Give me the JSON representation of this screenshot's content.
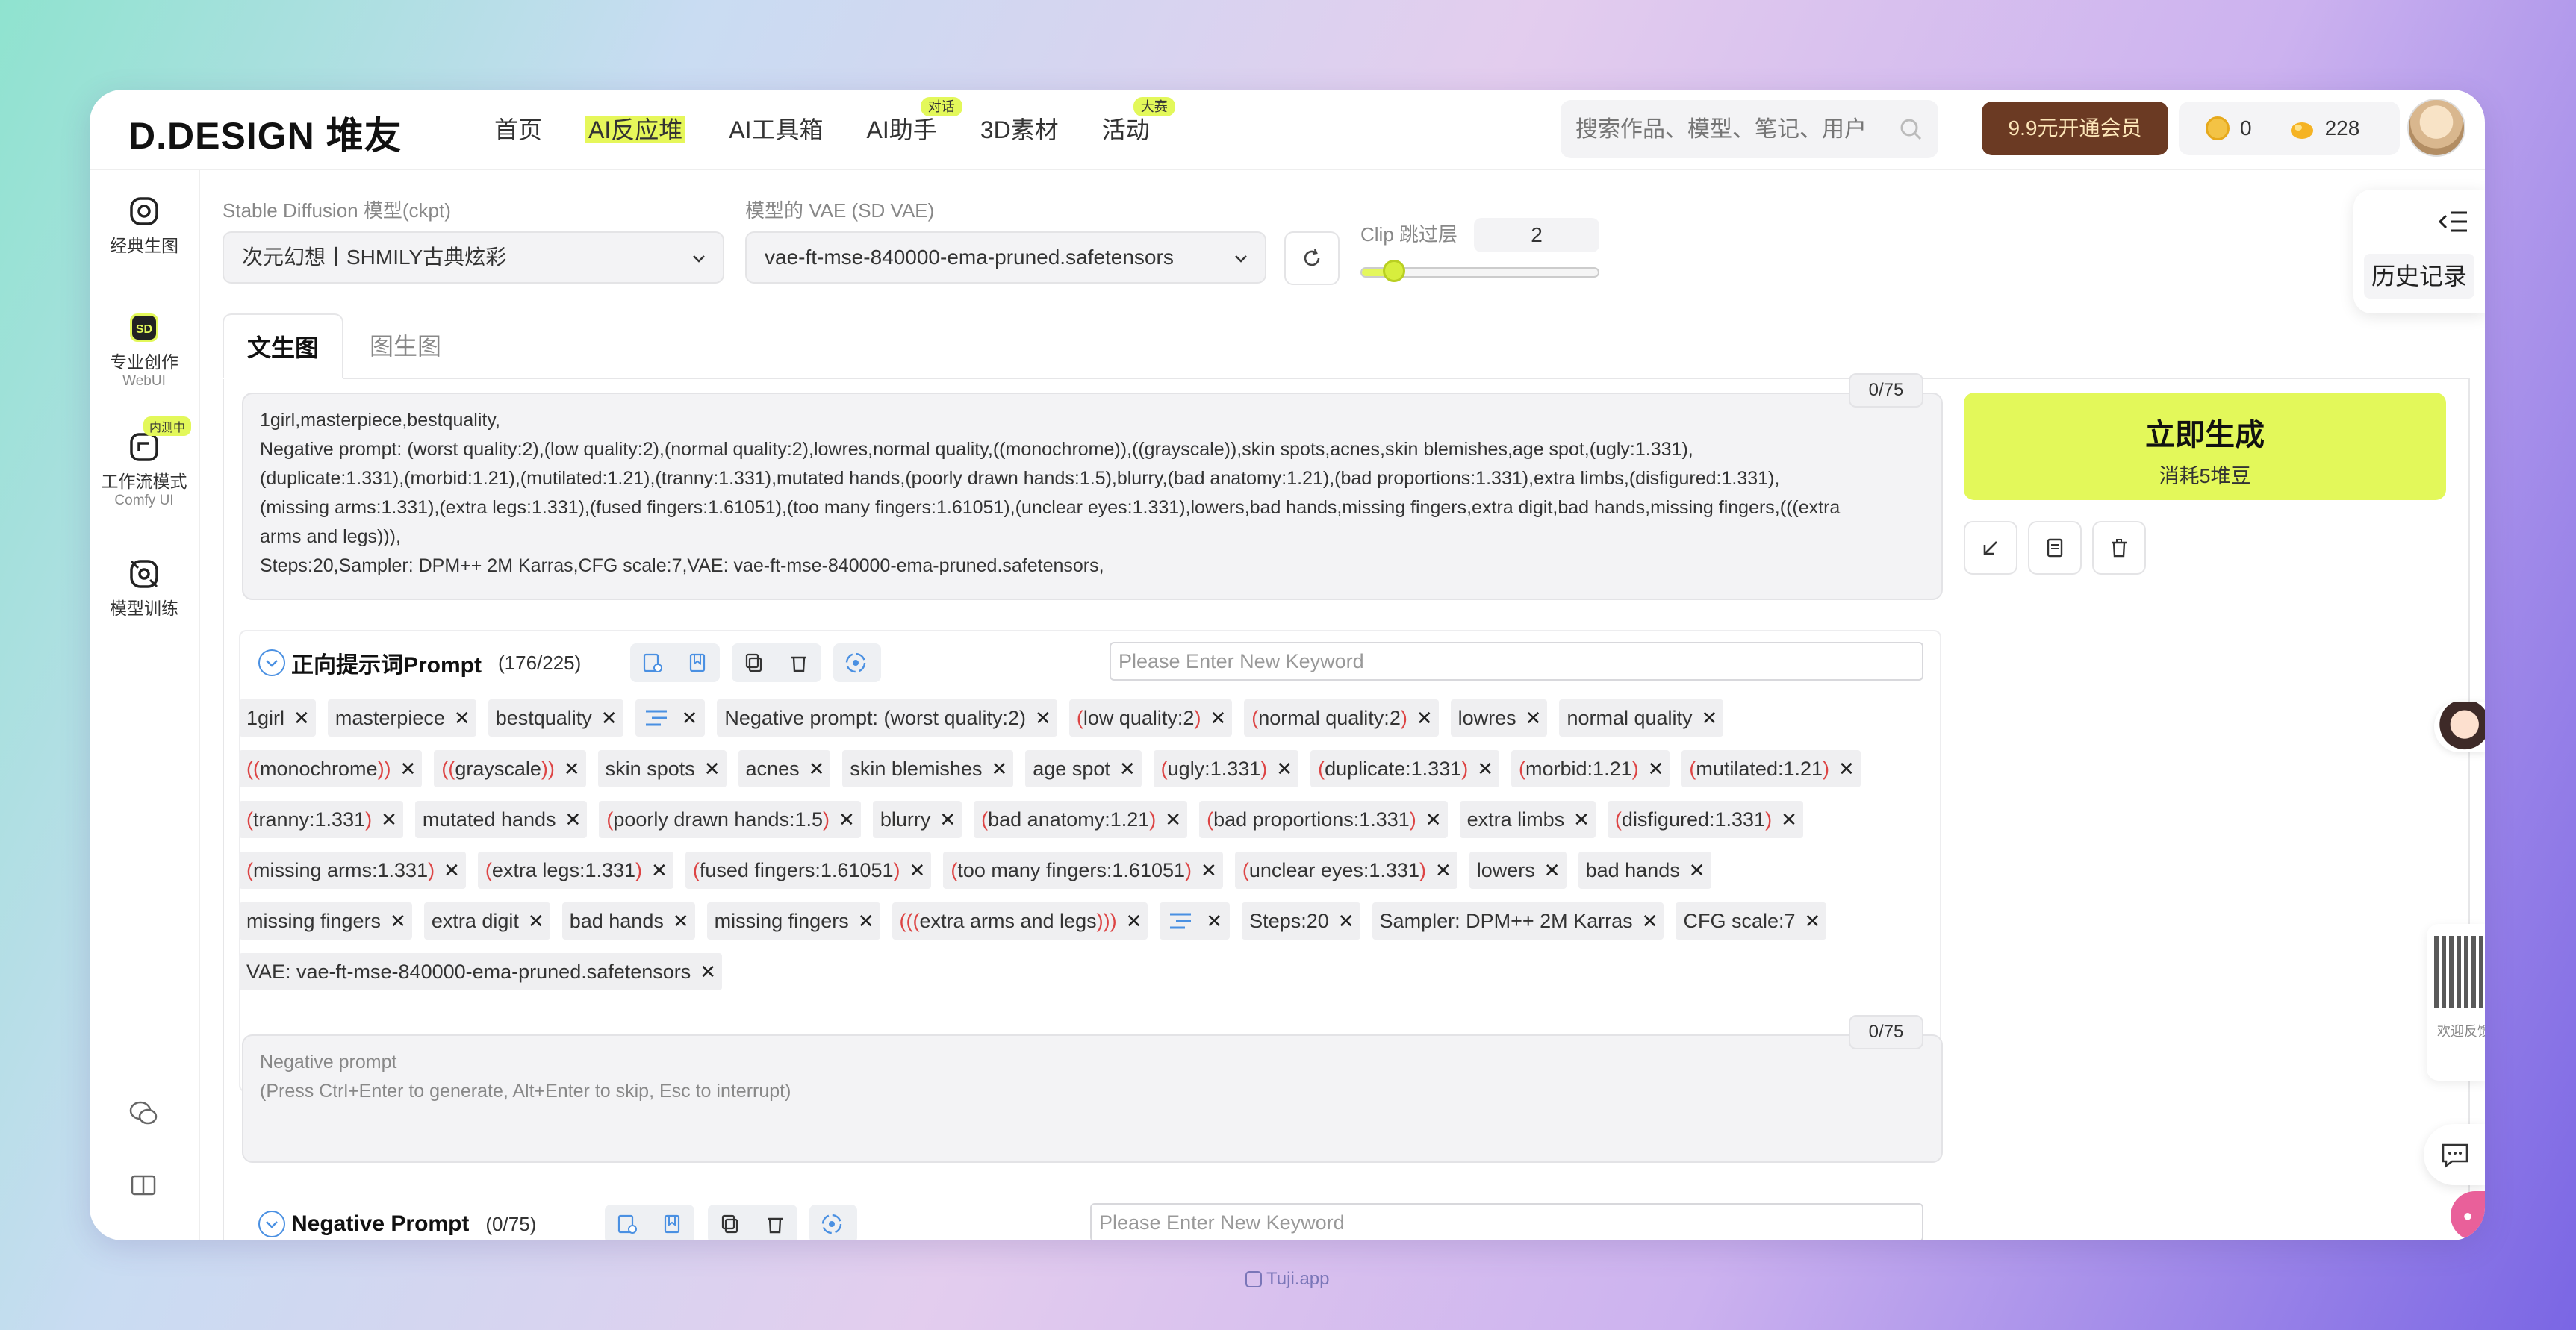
{
  "header": {
    "logo": "D.DESIGN 堆友",
    "nav": [
      {
        "label": "首页",
        "badge": ""
      },
      {
        "label": "AI反应堆",
        "badge": ""
      },
      {
        "label": "AI工具箱",
        "badge": ""
      },
      {
        "label": "AI助手",
        "badge": "对话"
      },
      {
        "label": "3D素材",
        "badge": ""
      },
      {
        "label": "活动",
        "badge": "大赛"
      }
    ],
    "search_placeholder": "搜索作品、模型、笔记、用户",
    "vip_label": "9.9元开通会员",
    "coins": "0",
    "beans": "228"
  },
  "rail": {
    "items": [
      {
        "label": "经典生图",
        "sub": "",
        "badge": ""
      },
      {
        "label": "专业创作",
        "sub": "WebUI",
        "badge": ""
      },
      {
        "label": "工作流模式",
        "sub": "Comfy UI",
        "badge": "内测中"
      },
      {
        "label": "模型训练",
        "sub": "",
        "badge": ""
      }
    ]
  },
  "settings": {
    "model_label": "Stable Diffusion 模型(ckpt)",
    "model_value": "次元幻想丨SHMILY古典炫彩",
    "vae_label": "模型的 VAE (SD VAE)",
    "vae_value": "vae-ft-mse-840000-ema-pruned.safetensors",
    "clip_label": "Clip 跳过层",
    "clip_value": "2",
    "clip_slider_fraction": 0.14
  },
  "history_label": "历史记录",
  "tabs": [
    "文生图",
    "图生图"
  ],
  "prompt": {
    "counter": "0/75",
    "text": "1girl,masterpiece,bestquality,\nNegative prompt: (worst quality:2),(low quality:2),(normal quality:2),lowres,normal quality,((monochrome)),((grayscale)),skin spots,acnes,skin blemishes,age spot,(ugly:1.331),\n(duplicate:1.331),(morbid:1.21),(mutilated:1.21),(tranny:1.331),mutated hands,(poorly drawn hands:1.5),blurry,(bad anatomy:1.21),(bad proportions:1.331),extra limbs,(disfigured:1.331),\n(missing arms:1.331),(extra legs:1.331),(fused fingers:1.61051),(too many fingers:1.61051),(unclear eyes:1.331),lowers,bad hands,missing fingers,extra digit,bad hands,missing fingers,(((extra\narms and legs))),\nSteps:20,Sampler: DPM++ 2M Karras,CFG scale:7,VAE: vae-ft-mse-840000-ema-pruned.safetensors,"
  },
  "generate": {
    "main": "立即生成",
    "sub": "消耗5堆豆"
  },
  "positive": {
    "title": "正向提示词Prompt",
    "count": "(176/225)",
    "keyword_placeholder": "Please Enter New Keyword",
    "rows": [
      [
        {
          "pre": "",
          "text": "1girl",
          "post": ""
        },
        {
          "pre": "",
          "text": "masterpiece",
          "post": ""
        },
        {
          "pre": "",
          "text": "bestquality",
          "post": ""
        },
        {
          "break": true
        },
        {
          "pre": "",
          "text": "Negative prompt: (worst quality:2)",
          "post": ""
        },
        {
          "pre": "(",
          "text": "low quality:2",
          "post": ")"
        },
        {
          "pre": "(",
          "text": "normal quality:2",
          "post": ")"
        },
        {
          "pre": "",
          "text": "lowres",
          "post": ""
        },
        {
          "pre": "",
          "text": "normal quality",
          "post": ""
        }
      ],
      [
        {
          "pre": "((",
          "text": "monochrome",
          "post": "))"
        },
        {
          "pre": "((",
          "text": "grayscale",
          "post": "))"
        },
        {
          "pre": "",
          "text": "skin spots",
          "post": ""
        },
        {
          "pre": "",
          "text": "acnes",
          "post": ""
        },
        {
          "pre": "",
          "text": "skin blemishes",
          "post": ""
        },
        {
          "pre": "",
          "text": "age spot",
          "post": ""
        },
        {
          "pre": "(",
          "text": "ugly:1.331",
          "post": ")"
        },
        {
          "pre": "(",
          "text": "duplicate:1.331",
          "post": ")"
        },
        {
          "pre": "(",
          "text": "morbid:1.21",
          "post": ")"
        },
        {
          "pre": "(",
          "text": "mutilated:1.21",
          "post": ")"
        }
      ],
      [
        {
          "pre": "(",
          "text": "tranny:1.331",
          "post": ")"
        },
        {
          "pre": "",
          "text": "mutated hands",
          "post": ""
        },
        {
          "pre": "(",
          "text": "poorly drawn hands:1.5",
          "post": ")"
        },
        {
          "pre": "",
          "text": "blurry",
          "post": ""
        },
        {
          "pre": "(",
          "text": "bad anatomy:1.21",
          "post": ")"
        },
        {
          "pre": "(",
          "text": "bad proportions:1.331",
          "post": ")"
        },
        {
          "pre": "",
          "text": "extra limbs",
          "post": ""
        },
        {
          "pre": "(",
          "text": "disfigured:1.331",
          "post": ")"
        }
      ],
      [
        {
          "pre": "(",
          "text": "missing arms:1.331",
          "post": ")"
        },
        {
          "pre": "(",
          "text": "extra legs:1.331",
          "post": ")"
        },
        {
          "pre": "(",
          "text": "fused fingers:1.61051",
          "post": ")"
        },
        {
          "pre": "(",
          "text": "too many fingers:1.61051",
          "post": ")"
        },
        {
          "pre": "(",
          "text": "unclear eyes:1.331",
          "post": ")"
        },
        {
          "pre": "",
          "text": "lowers",
          "post": ""
        },
        {
          "pre": "",
          "text": "bad hands",
          "post": ""
        }
      ],
      [
        {
          "pre": "",
          "text": "missing fingers",
          "post": ""
        },
        {
          "pre": "",
          "text": "extra digit",
          "post": ""
        },
        {
          "pre": "",
          "text": "bad hands",
          "post": ""
        },
        {
          "pre": "",
          "text": "missing fingers",
          "post": ""
        },
        {
          "pre": "(((",
          "text": "extra arms and legs",
          "post": ")))"
        },
        {
          "break": true
        },
        {
          "pre": "",
          "text": "Steps:20",
          "post": ""
        },
        {
          "pre": "",
          "text": "Sampler: DPM++ 2M Karras",
          "post": ""
        },
        {
          "pre": "",
          "text": "CFG scale:7",
          "post": ""
        }
      ],
      [
        {
          "pre": "",
          "text": "VAE: vae-ft-mse-840000-ema-pruned.safetensors",
          "post": ""
        }
      ]
    ]
  },
  "negative_textarea": {
    "counter": "0/75",
    "placeholder": "Negative prompt\n(Press Ctrl+Enter to generate, Alt+Enter to skip, Esc to interrupt)"
  },
  "negative": {
    "title": "Negative Prompt",
    "count": "(0/75)",
    "keyword_placeholder": "Please Enter New Keyword"
  },
  "feedback_label": "欢迎反馈",
  "watermark": "Tuji.app",
  "colors": {
    "accent": "#e3f85a",
    "vip": "#6b3a23",
    "paren": "#d44444",
    "link": "#4a90e2"
  }
}
